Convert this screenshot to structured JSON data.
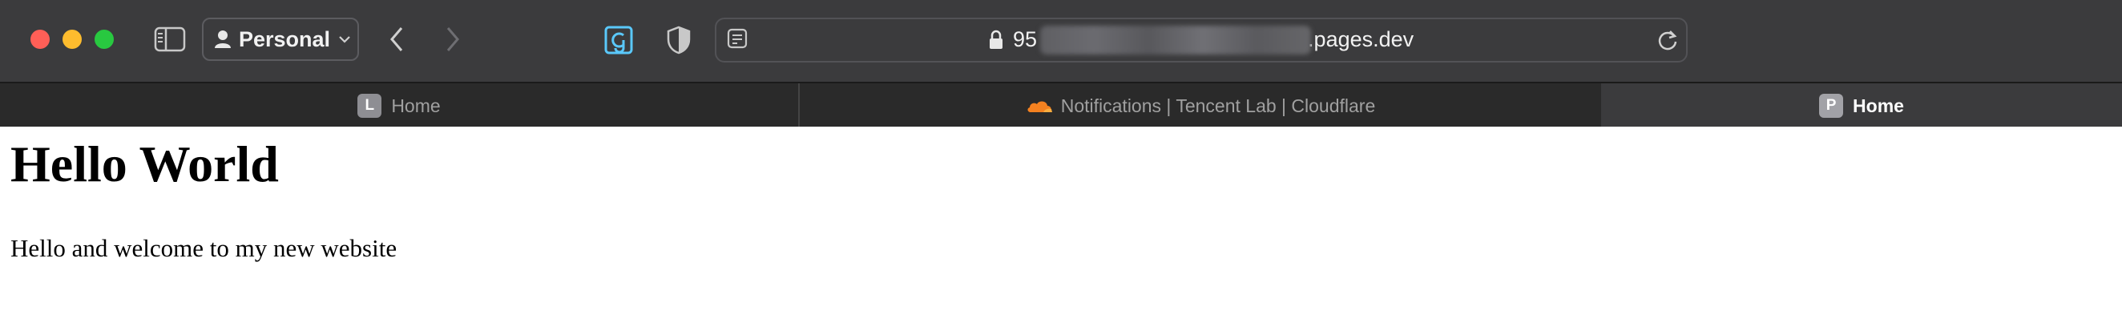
{
  "browser": {
    "profile_label": "Personal",
    "url_prefix": "95",
    "url_suffix": ".pages.dev",
    "colors": {
      "close": "#ff5f57",
      "minimize": "#febc2e",
      "zoom": "#28c840",
      "extension_accent": "#5ac8fa"
    }
  },
  "tabs": [
    {
      "label": "Home",
      "favicon_letter": "L"
    },
    {
      "label": "Notifications | Tencent Lab | Cloudflare",
      "favicon": "cloudflare-icon"
    },
    {
      "label": "Home",
      "favicon_letter": "P",
      "active": true
    }
  ],
  "page": {
    "heading": "Hello World",
    "body": "Hello and welcome to my new website"
  }
}
